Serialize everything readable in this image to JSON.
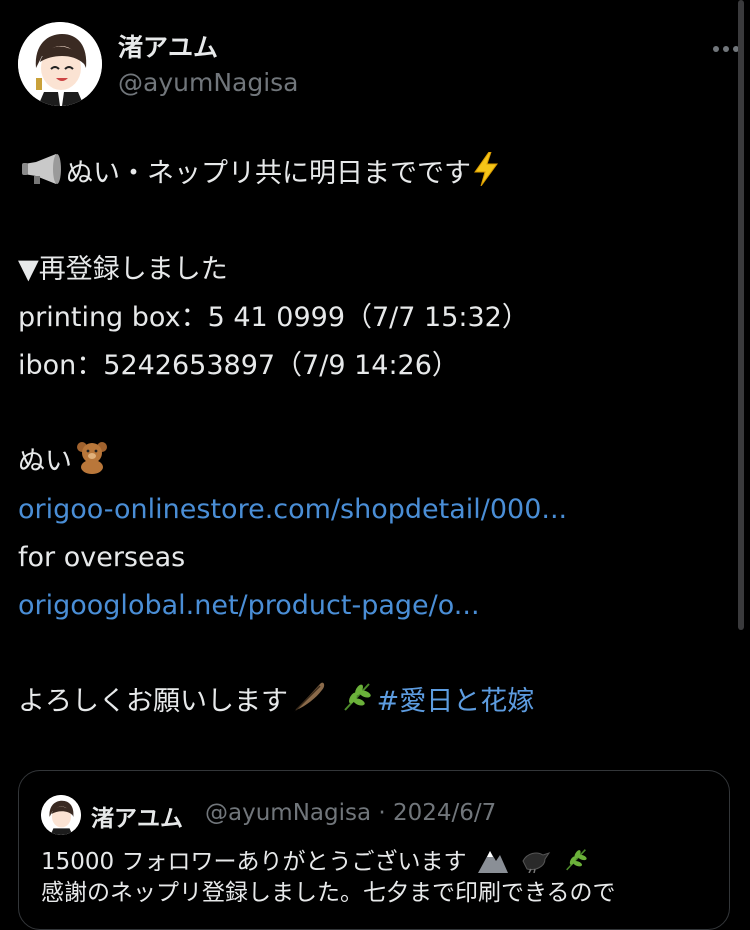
{
  "author": {
    "display_name": "渚アユム",
    "handle": "@ayumNagisa"
  },
  "post": {
    "line1": "ぬい・ネップリ共に明日までです",
    "line3": "▼再登録しました",
    "line4": "printing box：5 41 0999（7/7 15:32）",
    "line5": "ibon：5242653897（7/9 14:26）",
    "line7": "ぬい",
    "link1": "origoo-onlinestore.com/shopdetail/000...",
    "line9": "for overseas",
    "link2": "origooglobal.net/product-page/o...",
    "line12": "よろしくお願いします",
    "hashtag": "#愛日と花嫁"
  },
  "quote": {
    "display_name": "渚アユム",
    "handle_date": "@ayumNagisa · 2024/6/7",
    "line1": "15000 フォロワーありがとうございます",
    "line2": "感謝のネップリ登録しました。七夕まで印刷できるので"
  },
  "icons": {
    "more": "more-dots-icon",
    "megaphone": "megaphone-emoji",
    "lightning": "lightning-emoji",
    "teddy": "teddy-bear-emoji",
    "feather": "feather-emoji",
    "herb": "herb-emoji",
    "mountain": "mountain-emoji",
    "crow": "black-bird-emoji"
  },
  "colors": {
    "background": "#000000",
    "text": "#e7e9ea",
    "secondary": "#71767b",
    "link": "#4a8ed6"
  }
}
